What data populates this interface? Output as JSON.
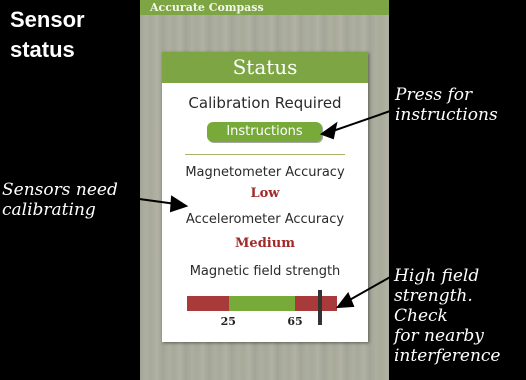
{
  "caption": {
    "title_line1": "Sensor",
    "title_line2": "status"
  },
  "app": {
    "title": "Accurate Compass"
  },
  "status_card": {
    "header": "Status",
    "calibration_text": "Calibration Required",
    "instructions_button": "Instructions",
    "magnetometer_label": "Magnetometer Accuracy",
    "magnetometer_value": "Low",
    "accelerometer_label": "Accelerometer Accuracy",
    "accelerometer_value": "Medium",
    "field_label": "Magnetic field strength",
    "field_scale": {
      "min": 0,
      "max": 90,
      "low_threshold": 25,
      "high_threshold": 65,
      "tick_25": "25",
      "tick_65": "65",
      "current_value": 80,
      "colors": {
        "low": "#a83a3a",
        "normal": "#78aa3a",
        "high": "#a83a3a",
        "needle": "#333333"
      }
    }
  },
  "annotations": {
    "press": {
      "line1": "Press for",
      "line2": "instructions"
    },
    "sensors": {
      "line1": "Sensors need",
      "line2": "calibrating"
    },
    "high_field": {
      "line1": "High field",
      "line2": "strength.",
      "line3": "Check",
      "line4": "for nearby",
      "line5": "interference"
    }
  },
  "colors": {
    "header_green": "#7ea544",
    "button_green": "#78aa3a",
    "value_red": "#a02a2a"
  }
}
